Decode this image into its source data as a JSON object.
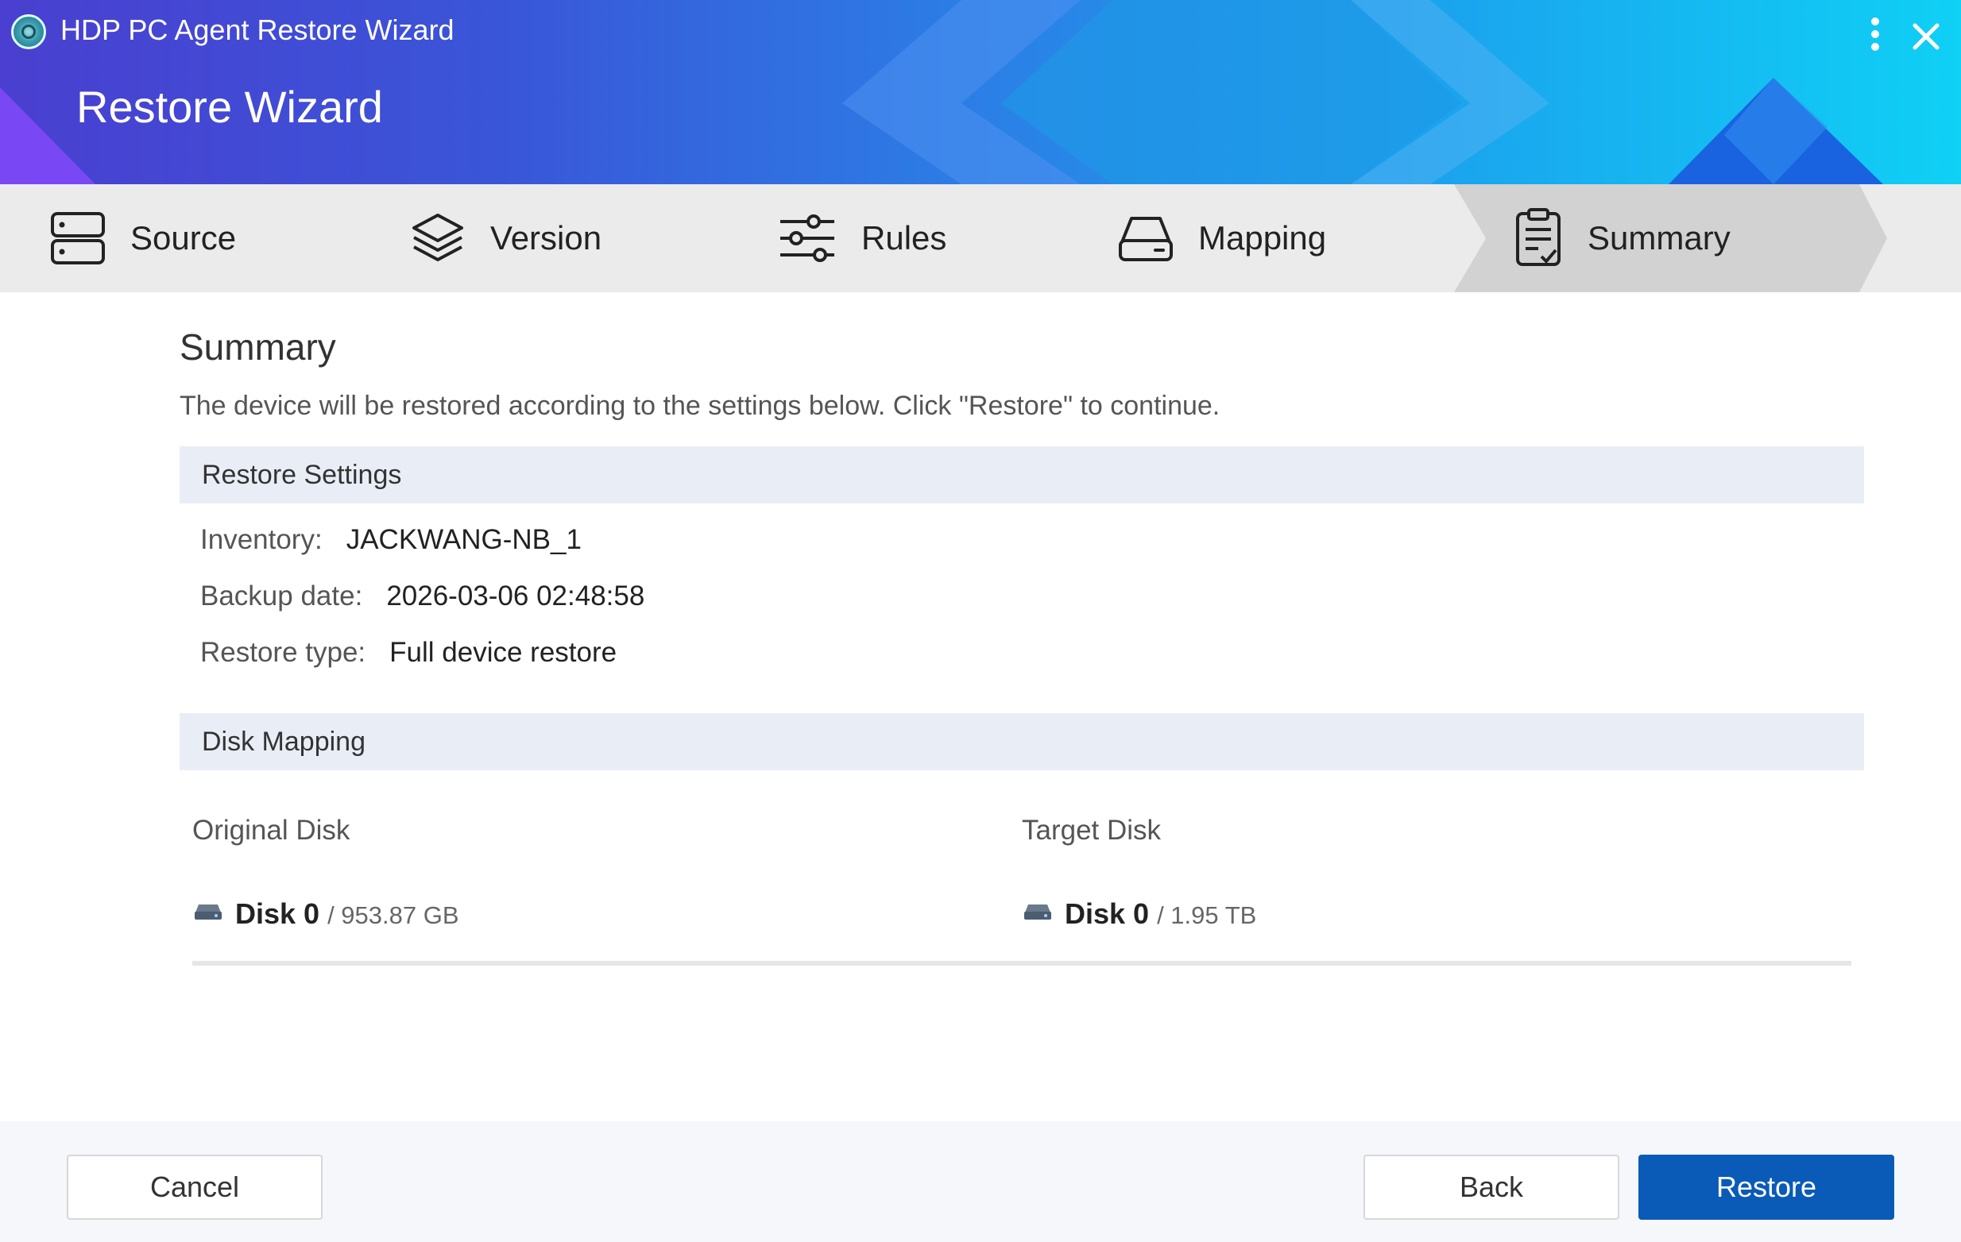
{
  "window": {
    "app_title": "HDP PC Agent Restore Wizard",
    "wizard_title": "Restore Wizard"
  },
  "steps": [
    {
      "label": "Source",
      "icon": "server-icon"
    },
    {
      "label": "Version",
      "icon": "layers-icon"
    },
    {
      "label": "Rules",
      "icon": "sliders-icon"
    },
    {
      "label": "Mapping",
      "icon": "drive-icon"
    },
    {
      "label": "Summary",
      "icon": "clipboard-check-icon",
      "active": true
    }
  ],
  "summary": {
    "title": "Summary",
    "description": "The device will be restored according to the settings below. Click \"Restore\" to continue."
  },
  "restore_settings": {
    "header": "Restore Settings",
    "inventory_label": "Inventory:",
    "inventory_value": "JACKWANG-NB_1",
    "backup_date_label": "Backup date:",
    "backup_date_value": "2026-03-06 02:48:58",
    "restore_type_label": "Restore type:",
    "restore_type_value": "Full device restore"
  },
  "disk_mapping": {
    "header": "Disk Mapping",
    "original_header": "Original Disk",
    "target_header": "Target Disk",
    "original": {
      "name": "Disk 0",
      "size": "/ 953.87 GB"
    },
    "target": {
      "name": "Disk 0",
      "size": "/ 1.95 TB"
    }
  },
  "footer": {
    "cancel": "Cancel",
    "back": "Back",
    "restore": "Restore"
  },
  "colors": {
    "primary": "#0a5ab8",
    "section_bg": "#e9eef6",
    "steps_bg": "#ebebeb"
  }
}
